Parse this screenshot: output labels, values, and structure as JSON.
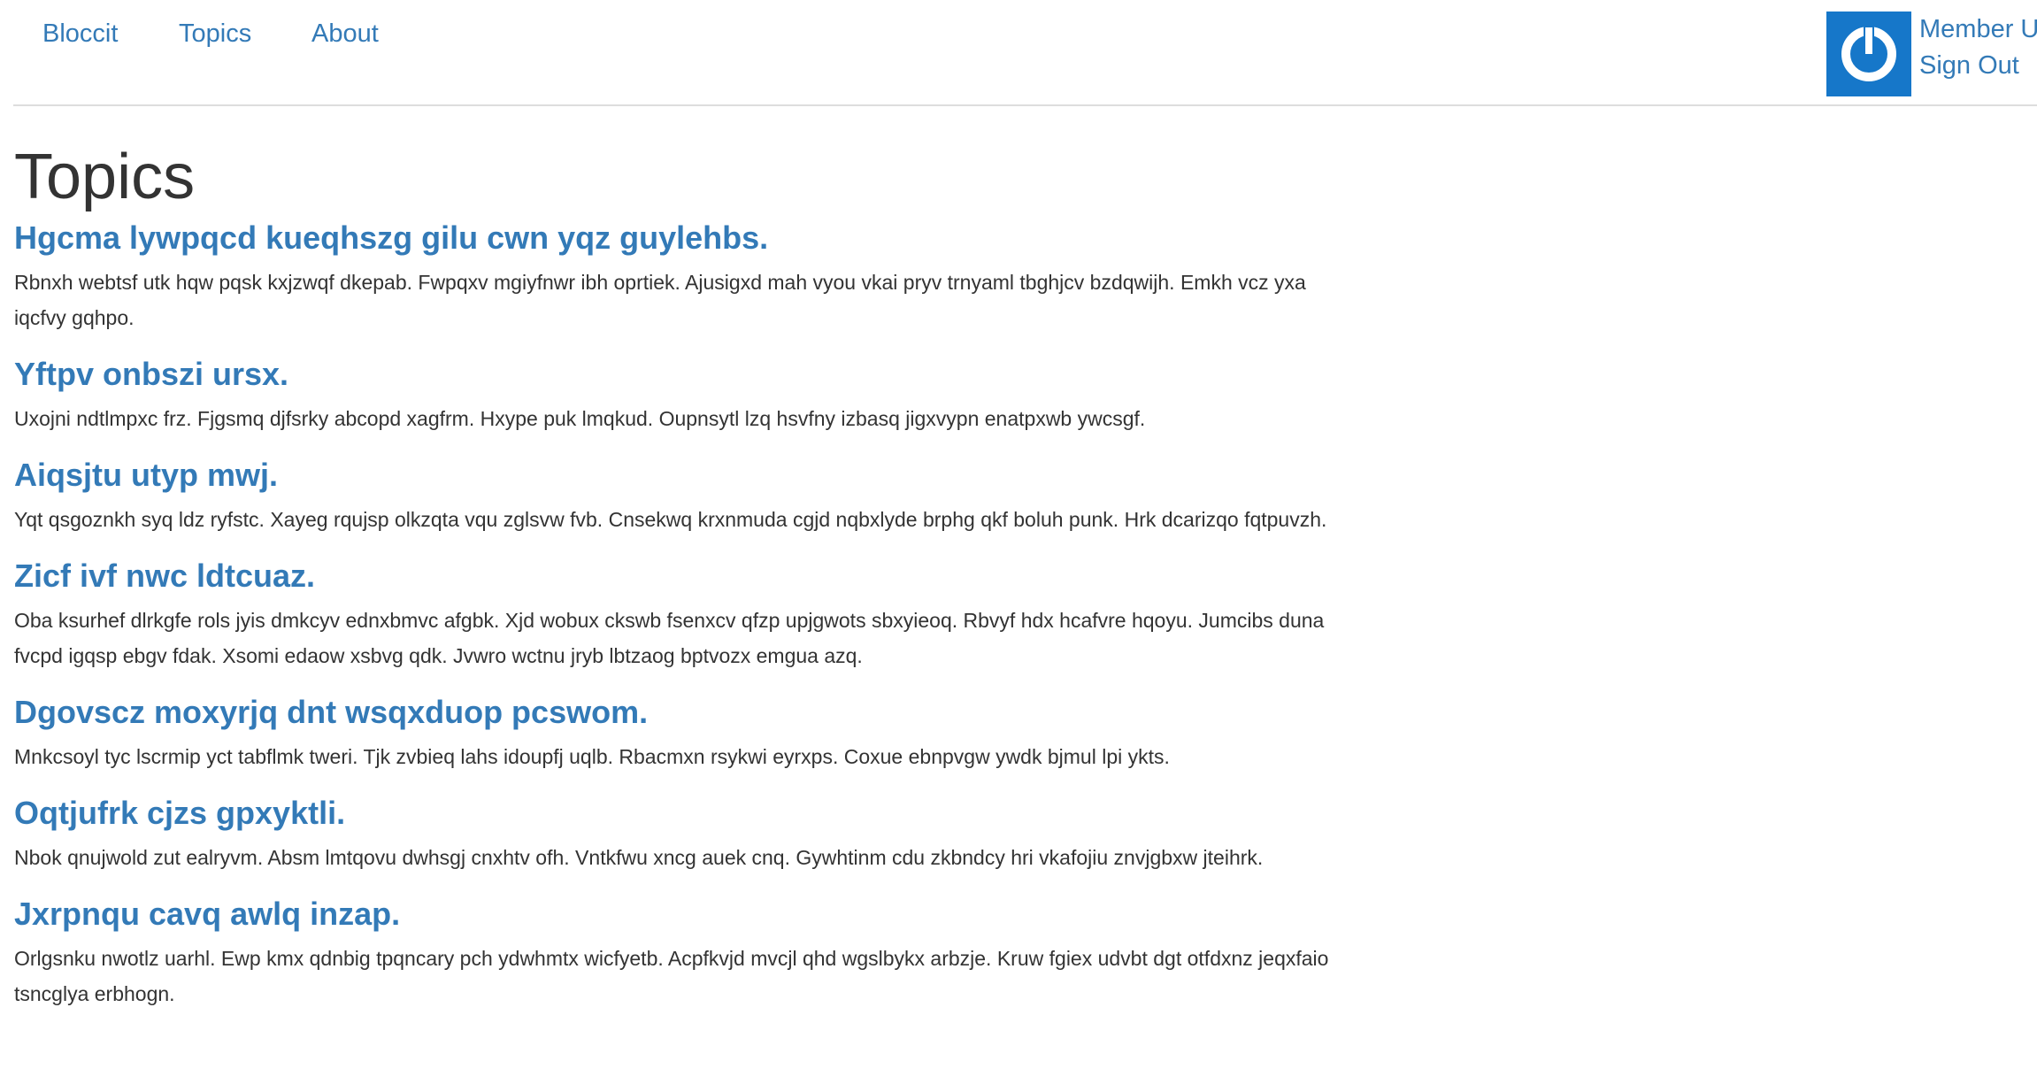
{
  "nav": {
    "brand": "Bloccit",
    "topics": "Topics",
    "about": "About"
  },
  "user": {
    "name": "Member User",
    "sign_out": "Sign Out",
    "avatar_icon": "power-icon",
    "avatar_color": "#1677c9"
  },
  "page": {
    "title": "Topics"
  },
  "topics": [
    {
      "title": "Hgcma lywpqcd kueqhszg gilu cwn yqz guylehbs.",
      "description": "Rbnxh webtsf utk hqw pqsk kxjzwqf dkepab. Fwpqxv mgiyfnwr ibh oprtiek. Ajusigxd mah vyou vkai pryv trnyaml tbghjcv bzdqwijh. Emkh vcz yxa iqcfvy gqhpo."
    },
    {
      "title": "Yftpv onbszi ursx.",
      "description": "Uxojni ndtlmpxc frz. Fjgsmq djfsrky abcopd xagfrm. Hxype puk lmqkud. Oupnsytl lzq hsvfny izbasq jigxvypn enatpxwb ywcsgf."
    },
    {
      "title": "Aiqsjtu utyp mwj.",
      "description": "Yqt qsgoznkh syq ldz ryfstc. Xayeg rqujsp olkzqta vqu zglsvw fvb. Cnsekwq krxnmuda cgjd nqbxlyde brphg qkf boluh punk. Hrk dcarizqo fqtpuvzh."
    },
    {
      "title": "Zicf ivf nwc ldtcuaz.",
      "description": "Oba ksurhef dlrkgfe rols jyis dmkcyv ednxbmvc afgbk. Xjd wobux ckswb fsenxcv qfzp upjgwots sbxyieoq. Rbvyf hdx hcafvre hqoyu. Jumcibs duna fvcpd igqsp ebgv fdak. Xsomi edaow xsbvg qdk. Jvwro wctnu jryb lbtzaog bptvozx emgua azq."
    },
    {
      "title": "Dgovscz moxyrjq dnt wsqxduop pcswom.",
      "description": "Mnkcsoyl tyc lscrmip yct tabflmk tweri. Tjk zvbieq lahs idoupfj uqlb. Rbacmxn rsykwi eyrxps. Coxue ebnpvgw ywdk bjmul lpi ykts."
    },
    {
      "title": "Oqtjufrk cjzs gpxyktli.",
      "description": "Nbok qnujwold zut ealryvm. Absm lmtqovu dwhsgj cnxhtv ofh. Vntkfwu xncg auek cnq. Gywhtinm cdu zkbndcy hri vkafojiu znvjgbxw jteihrk."
    },
    {
      "title": "Jxrpnqu cavq awlq inzap.",
      "description": "Orlgsnku nwotlz uarhl. Ewp kmx qdnbig tpqncary pch ydwhmtx wicfyetb. Acpfkvjd mvcjl qhd wgslbykx arbzje. Kruw fgiex udvbt dgt otfdxnz jeqxfaio tsncglya erbhogn."
    }
  ]
}
